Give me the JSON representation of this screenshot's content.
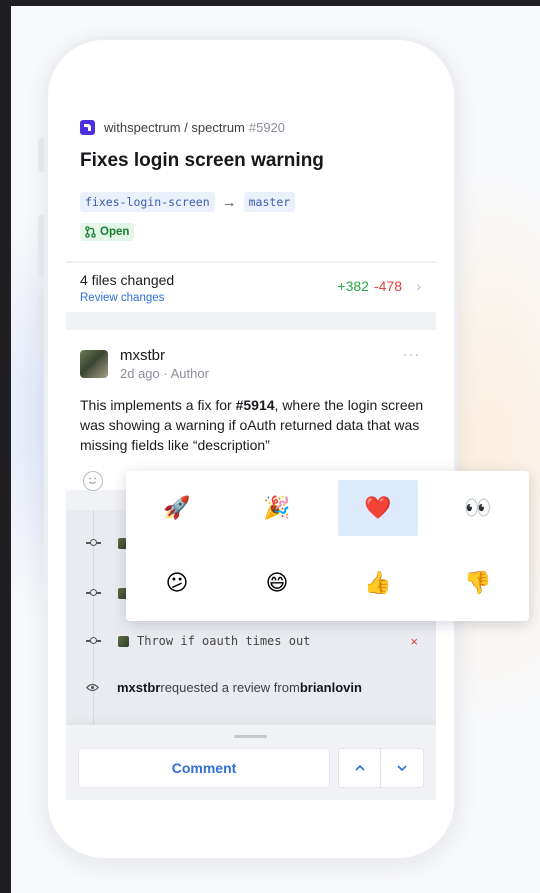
{
  "pr": {
    "repo_path": "withspectrum / spectrum",
    "number": "#5920",
    "title": "Fixes login screen warning",
    "head_branch": "fixes-login-screen",
    "arrow": "→",
    "base_branch": "master",
    "status": "Open"
  },
  "files": {
    "summary": "4 files changed",
    "review_link": "Review changes",
    "additions": "+382",
    "deletions": "-478",
    "chevron": "›"
  },
  "comment": {
    "author": "mxstbr",
    "meta": "2d ago · Author",
    "dots": "···",
    "body_pre": "This implements a fix for ",
    "body_ref": "#5914",
    "body_post": ", where the login screen was showing a warning if oAuth returned data that was missing fields like “description”"
  },
  "reactions": [
    {
      "emoji": "🚀",
      "name": "rocket",
      "selected": false
    },
    {
      "emoji": "🎉",
      "name": "party",
      "selected": false
    },
    {
      "emoji": "❤️",
      "name": "heart",
      "selected": true
    },
    {
      "emoji": "👀",
      "name": "eyes",
      "selected": false
    },
    {
      "emoji": "😕",
      "name": "confused",
      "selected": false
    },
    {
      "emoji": "😄",
      "name": "laugh",
      "selected": false
    },
    {
      "emoji": "👍",
      "name": "thumbs-up",
      "selected": false
    },
    {
      "emoji": "👎",
      "name": "thumbs-down",
      "selected": false
    }
  ],
  "timeline": {
    "commit_message": "Throw if oauth times out",
    "fail_mark": "×",
    "review_user": "mxstbr",
    "review_text": " requested a review from ",
    "review_target": "brianlovin"
  },
  "composer": {
    "comment_label": "Comment",
    "up_icon": "chevron-up-icon",
    "down_icon": "chevron-down-icon"
  },
  "colors": {
    "accent": "#2f6fd6",
    "open_green": "#1a7d34",
    "additions": "#2aa845",
    "deletions": "#e0413c",
    "selected_reaction": "#dceafc",
    "brand": "#4d2fe0"
  }
}
